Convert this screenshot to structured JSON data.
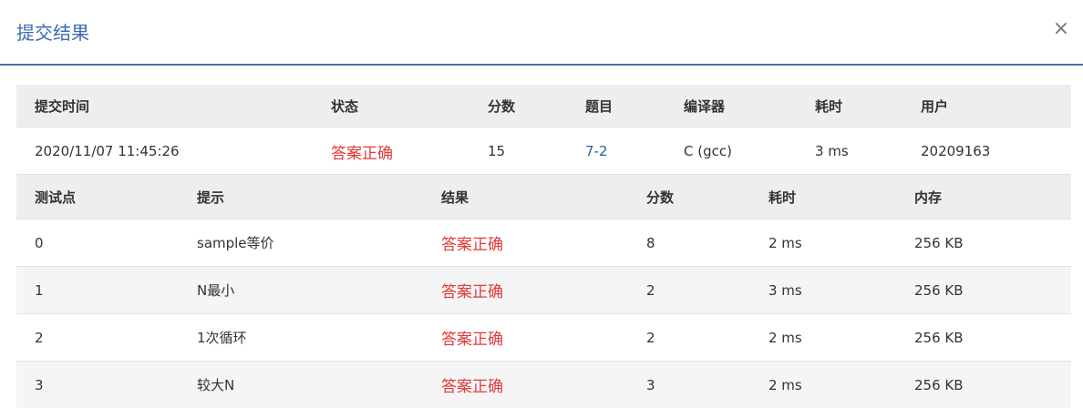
{
  "dialog": {
    "title": "提交结果",
    "close_label": "×"
  },
  "summary": {
    "headers": [
      "提交时间",
      "状态",
      "分数",
      "题目",
      "编译器",
      "耗时",
      "用户"
    ],
    "row": {
      "time": "2020/11/07 11:45:26",
      "status": "答案正确",
      "score": "15",
      "problem": "7-2",
      "compiler": "C (gcc)",
      "duration": "3 ms",
      "user": "20209163"
    }
  },
  "cases": {
    "headers": [
      "测试点",
      "提示",
      "结果",
      "分数",
      "耗时",
      "内存"
    ],
    "rows": [
      {
        "id": "0",
        "hint": "sample等价",
        "result": "答案正确",
        "score": "8",
        "time": "2 ms",
        "memory": "256 KB"
      },
      {
        "id": "1",
        "hint": "N最小",
        "result": "答案正确",
        "score": "2",
        "time": "3 ms",
        "memory": "256 KB"
      },
      {
        "id": "2",
        "hint": "1次循环",
        "result": "答案正确",
        "score": "2",
        "time": "2 ms",
        "memory": "256 KB"
      },
      {
        "id": "3",
        "hint": "较大N",
        "result": "答案正确",
        "score": "3",
        "time": "2 ms",
        "memory": "256 KB"
      }
    ]
  },
  "colors": {
    "accent": "#3a6db5",
    "status_ok": "#e03a3a",
    "link": "#2a5f9e",
    "header_bg": "#eeeeee"
  }
}
